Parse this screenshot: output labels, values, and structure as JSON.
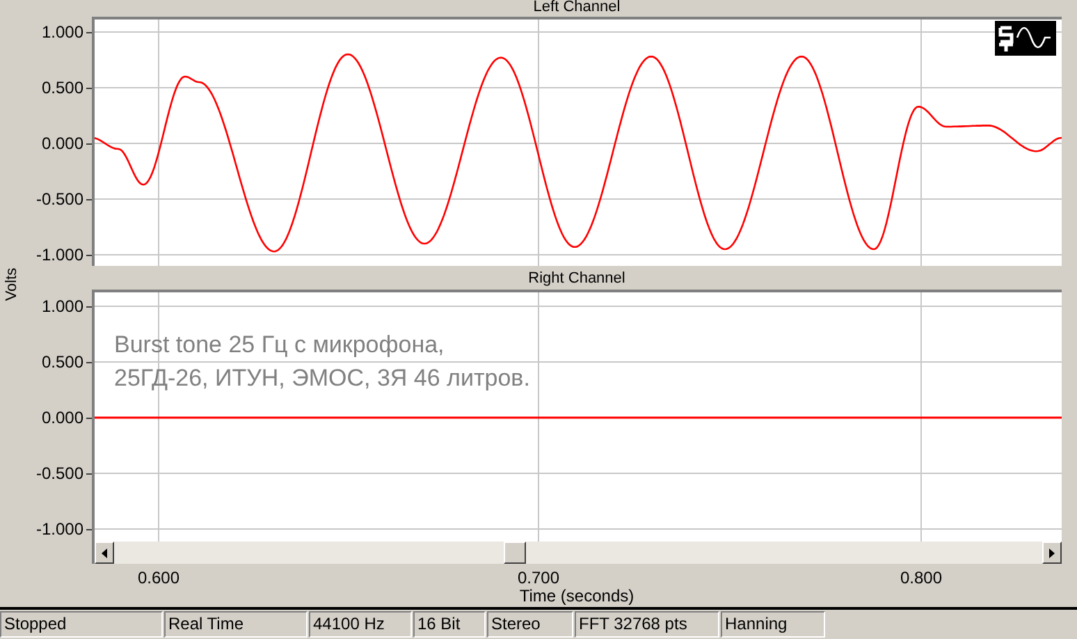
{
  "panels": [
    {
      "title": "Left Channel",
      "kind": "waveform",
      "y_ticks": [
        "1.000",
        "0.500",
        "0.000",
        "-0.500",
        "-1.000"
      ]
    },
    {
      "title": "Right Channel",
      "kind": "flat",
      "y_ticks": [
        "1.000",
        "0.500",
        "0.000",
        "-0.500",
        "-1.000"
      ],
      "note": [
        "Burst tone 25 Гц с микрофона,",
        "25ГД-26, ИТУН, ЭМОС, 3Я 46 литров."
      ]
    }
  ],
  "y_axis_label": "Volts",
  "x_ticks": [
    "0.600",
    "0.700",
    "0.800"
  ],
  "x_axis_label": "Time (seconds)",
  "status_bar": [
    "Stopped",
    "Real Time",
    "44100 Hz",
    "16 Bit",
    "Stereo",
    "FFT 32768 pts",
    "Hanning"
  ]
}
